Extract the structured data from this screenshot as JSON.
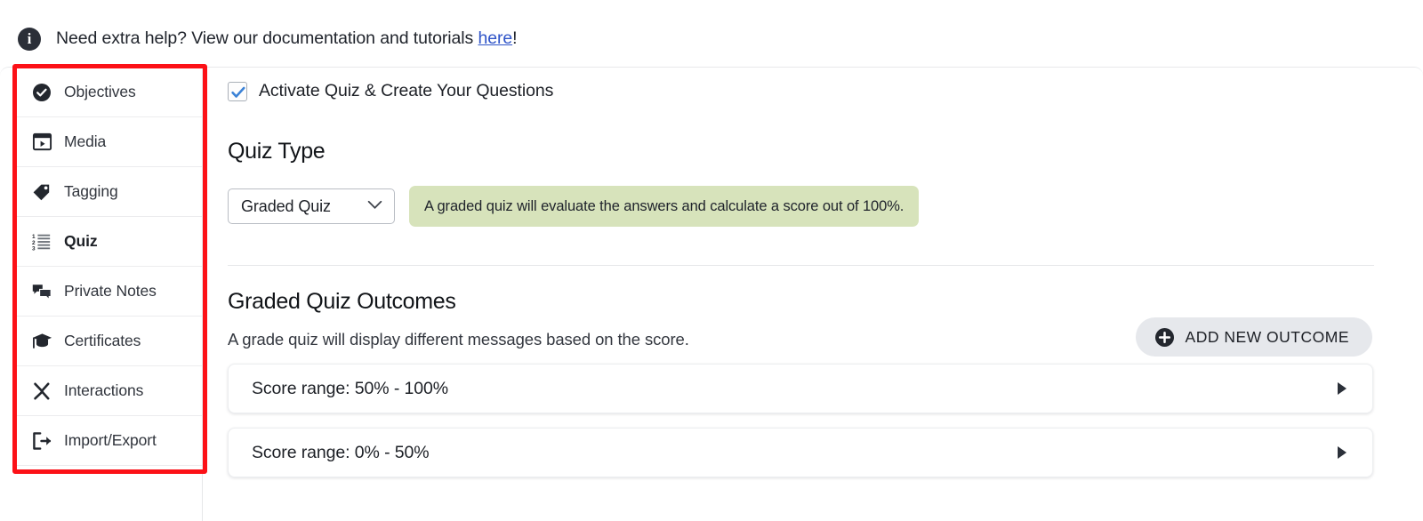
{
  "help_bar": {
    "icon": "info-circle-icon",
    "text_before": "Need extra help? View our documentation and tutorials ",
    "link_label": "here",
    "text_after": "!"
  },
  "sidebar": {
    "items": [
      {
        "label": "Objectives",
        "icon": "check-circle-icon",
        "active": false
      },
      {
        "label": "Media",
        "icon": "video-player-icon",
        "active": false
      },
      {
        "label": "Tagging",
        "icon": "tag-icon",
        "active": false
      },
      {
        "label": "Quiz",
        "icon": "numbered-list-icon",
        "active": true
      },
      {
        "label": "Private Notes",
        "icon": "chat-bubbles-icon",
        "active": false
      },
      {
        "label": "Certificates",
        "icon": "graduation-cap-icon",
        "active": false
      },
      {
        "label": "Interactions",
        "icon": "interactions-x-icon",
        "active": false
      },
      {
        "label": "Import/Export",
        "icon": "export-arrow-icon",
        "active": false
      }
    ]
  },
  "main": {
    "activate_checkbox": {
      "label": "Activate Quiz & Create Your Questions",
      "checked": true
    },
    "quiz_type": {
      "heading": "Quiz Type",
      "selected": "Graded Quiz",
      "options": [
        "Graded Quiz"
      ],
      "note": "A graded quiz will evaluate the answers and calculate a score out of 100%.",
      "note_bg": "#d7e3bb"
    },
    "outcomes": {
      "title": "Graded Quiz Outcomes",
      "subtitle": "A grade quiz will display different messages based on the score.",
      "add_button_label": "ADD NEW OUTCOME",
      "add_button_icon": "plus-circle-icon",
      "rows": [
        {
          "label": "Score range: 50% - 100%",
          "caret": "caret-right-icon"
        },
        {
          "label": "Score range: 0% - 50%",
          "caret": "caret-right-icon"
        }
      ]
    }
  },
  "annotation": {
    "highlight_color": "#fc1117"
  }
}
